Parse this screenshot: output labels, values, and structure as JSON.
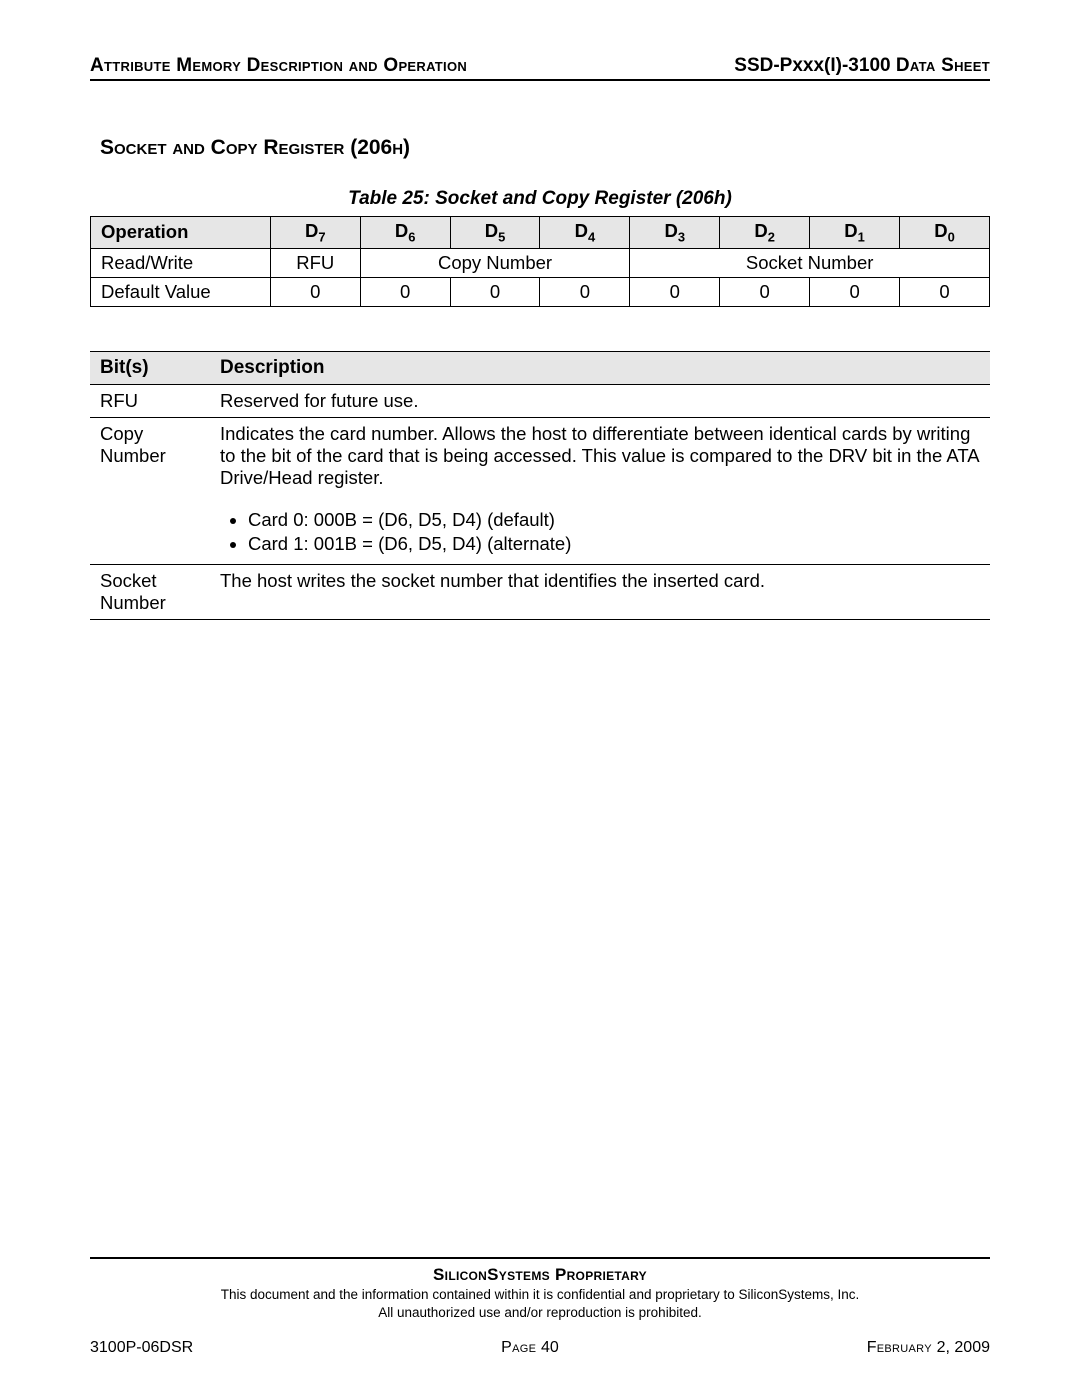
{
  "header": {
    "left": "Attribute Memory Description and Operation",
    "right_prefix": "SSD-Pxxx(I)-3100 ",
    "right_suffix": "Data Sheet"
  },
  "section_title": "Socket and Copy Register (206h)",
  "caption": "Table 25:  Socket and Copy Register (206h)",
  "reg_table": {
    "col_op": "Operation",
    "bits": [
      "D",
      "D",
      "D",
      "D",
      "D",
      "D",
      "D",
      "D"
    ],
    "bit_subs": [
      "7",
      "6",
      "5",
      "4",
      "3",
      "2",
      "1",
      "0"
    ],
    "row1_label": "Read/Write",
    "row1_d7": "RFU",
    "row1_copy": "Copy Number",
    "row1_socket": "Socket Number",
    "row2_label": "Default Value",
    "row2_vals": [
      "0",
      "0",
      "0",
      "0",
      "0",
      "0",
      "0",
      "0"
    ]
  },
  "bit_table": {
    "col_bits": "Bit(s)",
    "col_desc": "Description",
    "rows": [
      {
        "bits": "RFU",
        "desc": "Reserved for future use."
      },
      {
        "bits": "Copy Number",
        "desc": "Indicates the card number. Allows the host to differentiate between identical cards by writing to the bit of the card that is being accessed. This value is compared to the DRV bit in the ATA Drive/Head register.",
        "bullets": [
          "Card 0: 000B = (D6, D5, D4) (default)",
          "Card 1: 001B = (D6, D5, D4) (alternate)"
        ]
      },
      {
        "bits": "Socket Number",
        "desc": "The host writes the socket number that identifies the inserted card."
      }
    ]
  },
  "footer": {
    "proprietary": "SiliconSystems Proprietary",
    "conf1": "This document and the information contained within it is confidential and proprietary to SiliconSystems, Inc.",
    "conf2": "All unauthorized use and/or reproduction is prohibited.",
    "doc_num": "3100P-06DSR",
    "page_label": "Page ",
    "page_num": "40",
    "date_label": "February ",
    "date_rest": "2, 2009"
  }
}
